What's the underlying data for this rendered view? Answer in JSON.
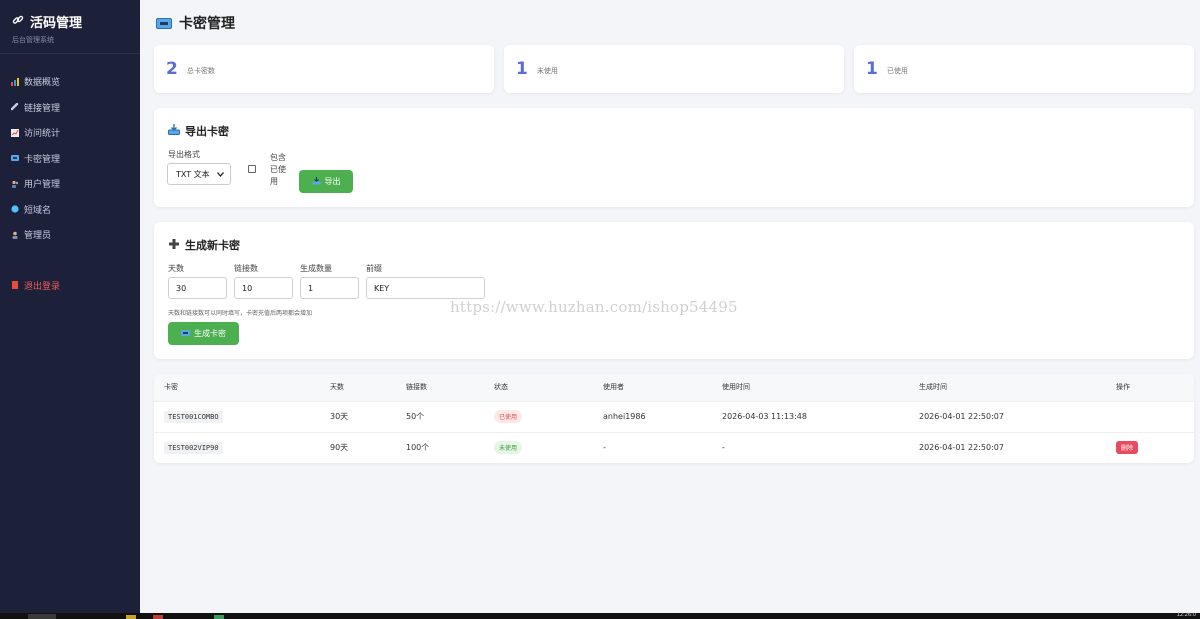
{
  "sidebar": {
    "brand_title": "活码管理",
    "brand_subtitle": "后台管理系统",
    "items": [
      {
        "label": "数据概览",
        "icon": "bar-chart-icon"
      },
      {
        "label": "链接管理",
        "icon": "link-icon"
      },
      {
        "label": "访问统计",
        "icon": "trend-chart-icon"
      },
      {
        "label": "卡密管理",
        "icon": "ticket-icon"
      },
      {
        "label": "用户管理",
        "icon": "users-icon"
      },
      {
        "label": "短域名",
        "icon": "globe-icon"
      },
      {
        "label": "管理员",
        "icon": "admin-icon"
      }
    ],
    "logout_label": "退出登录"
  },
  "page": {
    "title": "卡密管理"
  },
  "stats": [
    {
      "value": "2",
      "label": "总卡密数"
    },
    {
      "value": "1",
      "label": "未使用"
    },
    {
      "value": "1",
      "label": "已使用"
    }
  ],
  "export": {
    "title": "导出卡密",
    "format_label": "导出格式",
    "format_value": "TXT 文本",
    "include_used_label_1": "包含",
    "include_used_label_2": "已使",
    "include_used_label_3": "用",
    "include_used_checked": false,
    "button_label": "导出"
  },
  "generate": {
    "title": "生成新卡密",
    "days_label": "天数",
    "days_value": "30",
    "links_label": "链接数",
    "links_value": "10",
    "count_label": "生成数量",
    "count_value": "1",
    "prefix_label": "前缀",
    "prefix_value": "KEY",
    "hint": "天数和链接数可以同时填写，卡密充值后两项都会增加",
    "button_label": "生成卡密"
  },
  "watermark": "https://www.huzhan.com/ishop54495",
  "table": {
    "headers": [
      "卡密",
      "天数",
      "链接数",
      "状态",
      "使用者",
      "使用时间",
      "生成时间",
      "操作"
    ],
    "rows": [
      {
        "code": "TEST001COMBO",
        "days": "30天",
        "links": "50个",
        "status": "已使用",
        "user": "anhei1986",
        "used_at": "2026-04-03 11:13:48",
        "created_at": "2026-04-01 22:50:07",
        "action": ""
      },
      {
        "code": "TEST002VIP90",
        "days": "90天",
        "links": "100个",
        "status": "未使用",
        "user": "-",
        "used_at": "-",
        "created_at": "2026-04-01 22:50:07",
        "action": "删除"
      }
    ]
  },
  "taskbar": {
    "time": "12:26:0"
  },
  "colors": {
    "sidebar_bg": "#1c2038",
    "accent": "#5b6dd9",
    "green": "#4caf50",
    "danger": "#e84a5f"
  }
}
